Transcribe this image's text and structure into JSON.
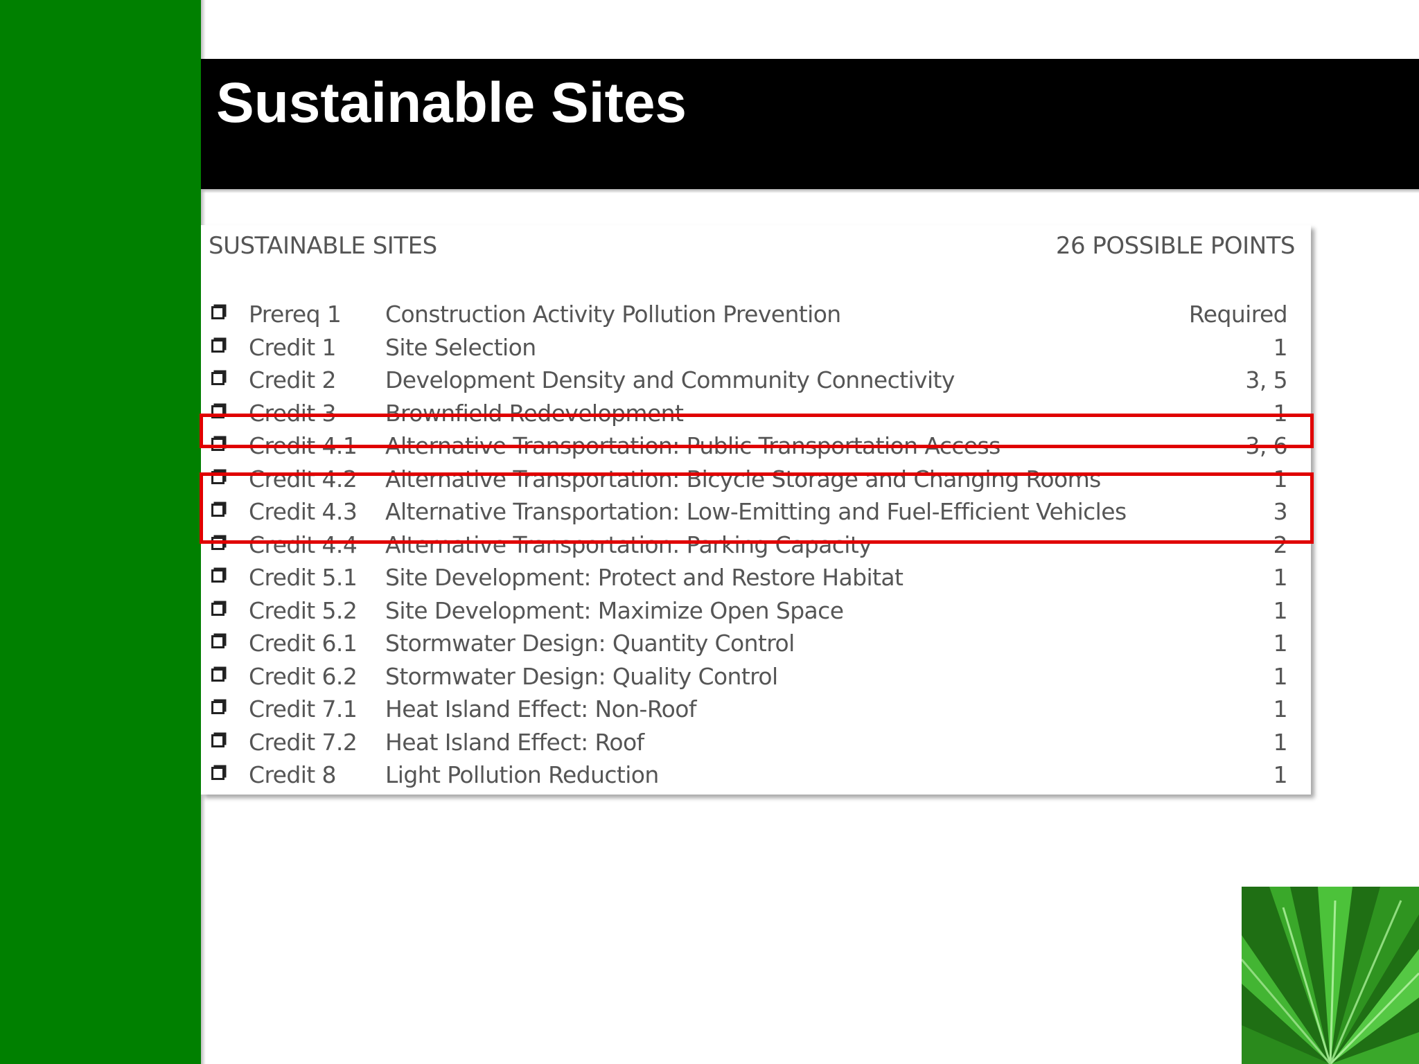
{
  "slide": {
    "title": "Sustainable Sites"
  },
  "table": {
    "heading": "SUSTAINABLE SITES",
    "possible_points": "26 POSSIBLE POINTS",
    "rows": [
      {
        "code": "Prereq 1",
        "description": "Construction Activity Pollution Prevention",
        "points": "Required",
        "highlighted": false
      },
      {
        "code": "Credit 1",
        "description": "Site Selection",
        "points": "1",
        "highlighted": false
      },
      {
        "code": "Credit 2",
        "description": "Development Density and Community Connectivity",
        "points": "3, 5",
        "highlighted": false
      },
      {
        "code": "Credit 3",
        "description": "Brownfield Redevelopment",
        "points": "1",
        "highlighted": false
      },
      {
        "code": "Credit 4.1",
        "description": "Alternative Transportation: Public Transportation Access",
        "points": "3, 6",
        "highlighted": true
      },
      {
        "code": "Credit 4.2",
        "description": "Alternative Transportation: Bicycle Storage and Changing Rooms",
        "points": "1",
        "highlighted": false
      },
      {
        "code": "Credit 4.3",
        "description": "Alternative Transportation: Low-Emitting and Fuel-Efficient Vehicles",
        "points": "3",
        "highlighted": true
      },
      {
        "code": "Credit 4.4",
        "description": "Alternative Transportation: Parking Capacity",
        "points": "2",
        "highlighted": true
      },
      {
        "code": "Credit 5.1",
        "description": "Site Development: Protect and Restore Habitat",
        "points": "1",
        "highlighted": false
      },
      {
        "code": "Credit 5.2",
        "description": "Site Development: Maximize Open Space",
        "points": "1",
        "highlighted": false
      },
      {
        "code": "Credit 6.1",
        "description": "Stormwater Design: Quantity Control",
        "points": "1",
        "highlighted": false
      },
      {
        "code": "Credit 6.2",
        "description": "Stormwater Design: Quality Control",
        "points": "1",
        "highlighted": false
      },
      {
        "code": "Credit 7.1",
        "description": "Heat Island Effect: Non-Roof",
        "points": "1",
        "highlighted": false
      },
      {
        "code": "Credit 7.2",
        "description": "Heat Island Effect: Roof",
        "points": "1",
        "highlighted": false
      },
      {
        "code": "Credit 8",
        "description": "Light Pollution Reduction",
        "points": "1",
        "highlighted": false
      }
    ]
  },
  "colors": {
    "sidebar_green": "#008000",
    "title_bar": "#000000",
    "highlight_red": "#e00000",
    "table_text": "#555555"
  },
  "decoration": {
    "corner_image": "green-leaf-image"
  }
}
